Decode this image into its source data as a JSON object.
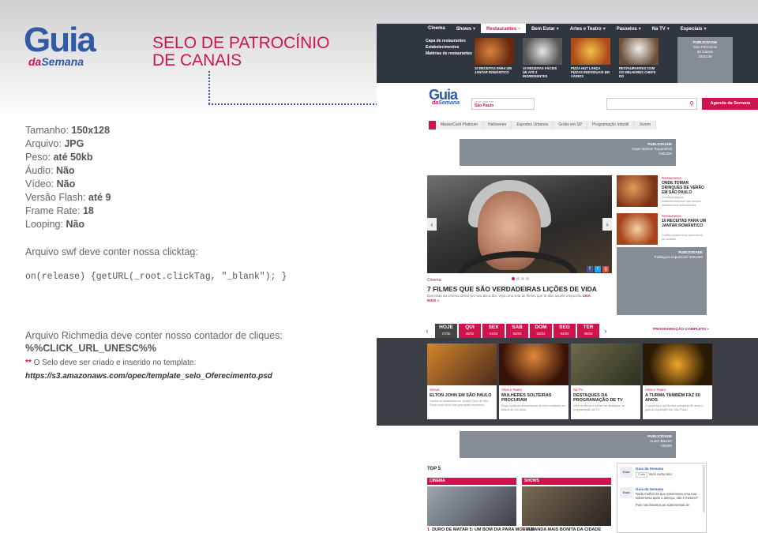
{
  "logo": {
    "word": "Guia",
    "prefix": "da",
    "suffix": "Semana"
  },
  "title": {
    "line1": "SELO DE PATROCÍNIO",
    "line2": "DE CANAIS"
  },
  "specs": [
    {
      "label": "Tamanho:",
      "value": "150x128"
    },
    {
      "label": "Arquivo:",
      "value": "JPG"
    },
    {
      "label": "Peso:",
      "value": "até 50kb"
    },
    {
      "label": "Áudio:",
      "value": "Não"
    },
    {
      "label": "Vídeo:",
      "value": "Não"
    },
    {
      "label": "Versão Flash:",
      "value": "até 9"
    },
    {
      "label": "Frame Rate:",
      "value": "18"
    },
    {
      "label": "Looping:",
      "value": "Não"
    }
  ],
  "notes": {
    "swf": "Arquivo swf deve conter nossa clicktag:",
    "code": "on(release) {getURL(_root.clickTag, \"_blank\"); }",
    "rich": "Arquivo Richmedia deve conter nosso contador de cliques:",
    "macro": "%%CLICK_URL_UNESC%%",
    "asterisk": "**",
    "selo": "O Selo deve ser criado e inserido no template:",
    "url": "https://s3.amazonaws.com/opec/template_selo_Oferecimento.psd"
  },
  "colors": {
    "brand": "#d0134c",
    "blue": "#2f5aa5",
    "nav": "#30363f",
    "ad": "#858c96",
    "dots": "#3355aa"
  },
  "site": {
    "nav": {
      "tabs": [
        "Cinema",
        "Shows",
        "Restaurantes",
        "Bem Estar",
        "Artes e Teatro",
        "Passeios",
        "Na TV",
        "Especiais"
      ],
      "submenu": [
        "Capa de restaurantes",
        "Estabelecimentos",
        "Matérias de restaurantes"
      ],
      "mega": [
        "10 RECEITAS PARA UM JANTAR ROMÂNTICO",
        "10 RECEITAS FÁCEIS DE ATÉ 3 INGREDIENTES",
        "PIZZA HUT LANÇA PIZZAS INDIVIDUAIS EM VÁRIOS",
        "RESTAURANTES COM OS MELHORES CHEFS DO"
      ],
      "pub": {
        "title": "PUBLICIDADE",
        "l1": "Selo Patrocínio",
        "l2": "de Canais",
        "l3": "150x128"
      }
    },
    "header": {
      "logo_word": "Guia",
      "logo_prefix": "da",
      "logo_suffix": "Semana",
      "loc_label": "você está em",
      "loc_city": "São Paulo",
      "agenda": "Agenda da Semana"
    },
    "tags": [
      "MasterCard Platinum",
      "Halloween",
      "Esportes Urbanos",
      "Grátis em SP",
      "Programação Infantil",
      "Jovem"
    ],
    "ad1": {
      "title": "PUBLICIDADE",
      "l1": "Super Banner Expansível",
      "l2": "728x300"
    },
    "hero": {
      "category": "Cinema",
      "title": "7 FILMES QUE SÃO VERDADEIRAS LIÇÕES DE VIDA",
      "desc": "Das telas do cinema direto pro seu dia a dia. Veja uma lista de filmes que te dão aquele empurrão",
      "leia": "LEIA",
      "mais": "MAIS »"
    },
    "side": [
      {
        "cat": "Restaurantes",
        "title": "ONDE TOMAR DRINQUES DE VERÃO EM SÃO PAULO",
        "desc": "Conheça alguns estabelecimentos que servem bebidas bem refrescantes"
      },
      {
        "cat": "Restaurantes",
        "title": "10 RECEITAS PARA UM JANTAR ROMÂNTICO",
        "desc": "Confira pratos ricos para servir na ocasião"
      }
    ],
    "ad2": {
      "title": "PUBLICIDADE",
      "l1": "Fatãoguia expansível 300x250"
    },
    "days": [
      {
        "d": "HOJE",
        "dt": "27/02"
      },
      {
        "d": "QUI",
        "dt": "28/02"
      },
      {
        "d": "SEX",
        "dt": "01/03"
      },
      {
        "d": "SAB",
        "dt": "02/03"
      },
      {
        "d": "DOM",
        "dt": "03/03"
      },
      {
        "d": "SEG",
        "dt": "04/03"
      },
      {
        "d": "TER",
        "dt": "05/03"
      }
    ],
    "prog": "PROGRAMAÇÃO COMPLETA »",
    "rich_cards": [
      {
        "cat": "Shows",
        "title": "ELTON JOHN EM SÃO PAULO",
        "desc": "Cantor se apresenta no Jockey Club de São Paulo com show dos principais sucessos"
      },
      {
        "cat": "Artes e Teatro",
        "title": "MULHERES SOLTEIRAS PROCURAM",
        "desc": "Peça conta as desventuras de três mulheres em busca de um amor"
      },
      {
        "cat": "Na TV",
        "title": "DESTAQUES DA PROGRAMAÇÃO DE TV",
        "desc": "Veja os filmes e séries de destaque na programação da TV"
      },
      {
        "cat": "Artes e Teatro",
        "title": "A TURMA TAMBÉM FAZ 50 ANOS",
        "desc": "O quadrinho da Mônica completa 50 anos e ganha exposição em São Paulo"
      }
    ],
    "ad3": {
      "title": "PUBLICIDADE",
      "l1": "Super Banner",
      "l2": "728x90"
    },
    "top5": "TOP 5",
    "sections": [
      {
        "name": "CINEMA",
        "item": "DURO DE MATAR 5: UM BOM DIA PARA MORRER",
        "num": "1"
      },
      {
        "name": "SHOWS",
        "item": "A BANDA MAIS BONITA DA CIDADE",
        "num": "1"
      }
    ],
    "fb": {
      "page": "Guia da Semana",
      "like": "Curtir",
      "like_text": "Você curtiu isso.",
      "post_name": "Guia da Semana",
      "post_text": "Nada melhor do que sobremesa uma boa sobremesa após o almoço, não é mesmo?",
      "post2": "Pois nós listamos as sobremesas de"
    }
  }
}
